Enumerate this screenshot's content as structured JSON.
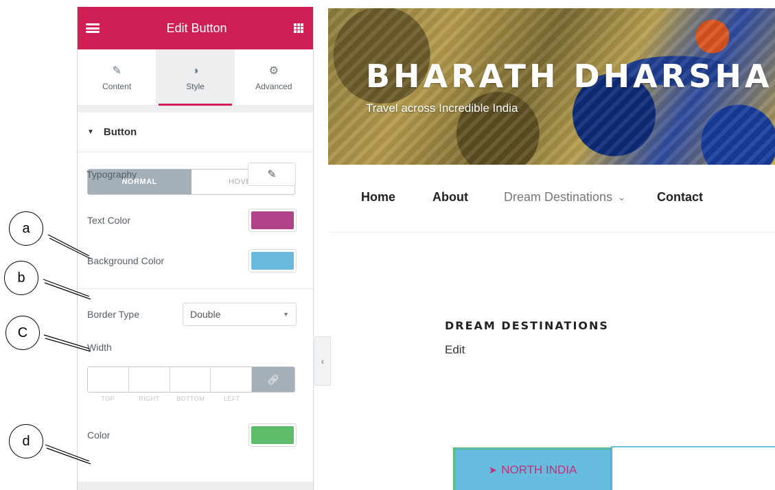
{
  "panel": {
    "title": "Edit Button",
    "tabs": [
      {
        "label": "Content",
        "icon": "pencil-icon"
      },
      {
        "label": "Style",
        "icon": "half-circle-icon"
      },
      {
        "label": "Advanced",
        "icon": "gear-icon"
      }
    ],
    "active_tab": "Style",
    "section_title": "Button",
    "typography_label": "Typography",
    "state_tabs": [
      "NORMAL",
      "HOVER"
    ],
    "text_color_label": "Text Color",
    "text_color": "#b0428a",
    "background_color_label": "Background Color",
    "background_color": "#6cbbde",
    "border_type_label": "Border Type",
    "border_type_value": "Double",
    "width_label": "Width",
    "width_sides": [
      "TOP",
      "RIGHT",
      "BOTTOM",
      "LEFT"
    ],
    "color_label": "Color",
    "border_color": "#5cbc6a"
  },
  "site": {
    "title": "BHARATH DHARSHA",
    "tagline": "Travel across Incredible India",
    "nav": [
      "Home",
      "About",
      "Dream Destinations",
      "Contact"
    ],
    "heading": "DREAM DESTINATIONS",
    "edit_link": "Edit",
    "button_label": "NORTH INDIA"
  },
  "callouts": [
    "a",
    "b",
    "C",
    "d"
  ],
  "colors": {
    "accent": "#cf1f55",
    "toggle_gray": "#a4afb7"
  }
}
